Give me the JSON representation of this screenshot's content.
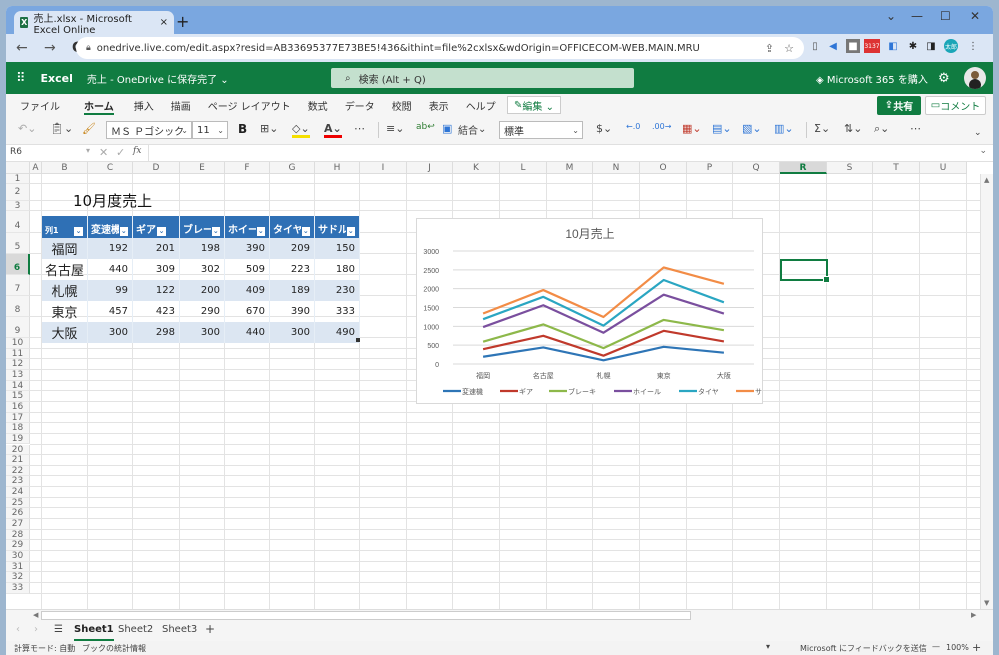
{
  "browser": {
    "tab_title": "売上.xlsx - Microsoft Excel Online",
    "tab_close": "×",
    "new_tab": "+",
    "url": "onedrive.live.com/edit.aspx?resid=AB33695377E73BE5!436&ithint=file%2cxlsx&wdOrigin=OFFICECOM-WEB.MAIN.MRU",
    "controls": {
      "dropdown": "⌄",
      "minimize": "—",
      "maximize": "☐",
      "close": "✕"
    },
    "nav": {
      "back": "←",
      "forward": "→",
      "reload": "C"
    },
    "ext_badge": "3137"
  },
  "app": {
    "name": "Excel",
    "doc_title": "売上 - OneDrive に保存完了 ⌄",
    "search_placeholder": "検索 (Alt + Q)",
    "buy_label": "Microsoft 365 を購入"
  },
  "ribbon": {
    "tabs": [
      "ファイル",
      "ホーム",
      "挿入",
      "描画",
      "ページ レイアウト",
      "数式",
      "データ",
      "校閲",
      "表示",
      "ヘルプ"
    ],
    "active_tab": "ホーム",
    "edit_mode": "編集 ⌄",
    "share": "共有",
    "comment": "コメント",
    "font_name": "ＭＳ Ｐゴシック",
    "font_size": "11",
    "bold": "B",
    "merge": "結合",
    "number_format": "標準",
    "currency": "$",
    "more": "⋯"
  },
  "formula_bar": {
    "name_box": "R6",
    "fx": "fx",
    "value": ""
  },
  "grid": {
    "columns": [
      "A",
      "B",
      "C",
      "D",
      "E",
      "F",
      "G",
      "H",
      "I",
      "J",
      "K",
      "L",
      "M",
      "N",
      "O",
      "P",
      "Q",
      "R",
      "S",
      "T",
      "U"
    ],
    "active_column": "R",
    "rows": [
      "1",
      "2",
      "3",
      "4",
      "5",
      "6",
      "7",
      "8",
      "9",
      "10",
      "11",
      "12",
      "13",
      "14",
      "15",
      "16",
      "17",
      "18",
      "19",
      "20",
      "21",
      "22",
      "23",
      "24",
      "25",
      "26",
      "27",
      "28",
      "29",
      "30",
      "31",
      "32",
      "33"
    ],
    "active_row": "6",
    "selected_cell": "R6",
    "sheet_title": "10月度売上"
  },
  "table": {
    "headers": [
      "列1",
      "変速機",
      "ギア",
      "ブレー",
      "ホイー",
      "タイヤ",
      "サドル"
    ],
    "rows": [
      {
        "city": "福岡",
        "values": [
          "192",
          "201",
          "198",
          "390",
          "209",
          "150"
        ]
      },
      {
        "city": "名古屋",
        "values": [
          "440",
          "309",
          "302",
          "509",
          "223",
          "180"
        ]
      },
      {
        "city": "札幌",
        "values": [
          "99",
          "122",
          "200",
          "409",
          "189",
          "230"
        ]
      },
      {
        "city": "東京",
        "values": [
          "457",
          "423",
          "290",
          "670",
          "390",
          "333"
        ]
      },
      {
        "city": "大阪",
        "values": [
          "300",
          "298",
          "300",
          "440",
          "300",
          "490"
        ]
      }
    ]
  },
  "chart_data": {
    "type": "line",
    "stacked": true,
    "title": "10月売上",
    "xlabel": "",
    "ylabel": "",
    "categories": [
      "福岡",
      "名古屋",
      "札幌",
      "東京",
      "大阪"
    ],
    "ylim": [
      0,
      3000
    ],
    "yticks": [
      0,
      500,
      1000,
      1500,
      2000,
      2500,
      3000
    ],
    "grid": true,
    "legend": "bottom",
    "series": [
      {
        "name": "変速機",
        "color": "#2e75b6",
        "values": [
          192,
          440,
          99,
          457,
          300
        ]
      },
      {
        "name": "ギア",
        "color": "#c0392b",
        "values": [
          201,
          309,
          122,
          423,
          298
        ]
      },
      {
        "name": "ブレーキ",
        "color": "#8db84a",
        "values": [
          198,
          302,
          200,
          290,
          300
        ]
      },
      {
        "name": "ホイール",
        "color": "#7a4f9e",
        "values": [
          390,
          509,
          409,
          670,
          440
        ]
      },
      {
        "name": "タイヤ",
        "color": "#2aa6c2",
        "values": [
          209,
          223,
          189,
          390,
          300
        ]
      },
      {
        "name": "サドル",
        "color": "#f28c46",
        "values": [
          150,
          180,
          230,
          333,
          490
        ]
      }
    ]
  },
  "sheets": {
    "tabs": [
      "Sheet1",
      "Sheet2",
      "Sheet3"
    ],
    "active": "Sheet1",
    "add": "+",
    "menu": "☰"
  },
  "status": {
    "calc_mode": "計算モード: 自動",
    "stats": "ブックの統計情報",
    "feedback": "Microsoft にフィードバックを送信",
    "zoom": "100%",
    "zoom_out": "—",
    "zoom_in": "+"
  },
  "colors": {
    "excel_green": "#107c41",
    "table_header": "#2f70b5",
    "table_band": "#dce6f2"
  }
}
